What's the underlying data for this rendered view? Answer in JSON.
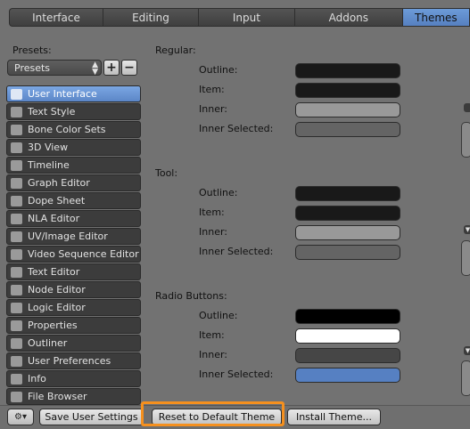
{
  "tabs": [
    {
      "label": "Interface",
      "active": false
    },
    {
      "label": "Editing",
      "active": false
    },
    {
      "label": "Input",
      "active": false
    },
    {
      "label": "Addons",
      "active": false
    },
    {
      "label": "Themes",
      "active": true
    }
  ],
  "presets": {
    "label": "Presets:",
    "selected": "Presets",
    "add": "+",
    "remove": "−"
  },
  "sidebar": {
    "items": [
      {
        "label": "User Interface",
        "icon": "user-interface-icon",
        "active": true
      },
      {
        "label": "Text Style",
        "icon": "text-style-icon"
      },
      {
        "label": "Bone Color Sets",
        "icon": "bone-color-sets-icon"
      },
      {
        "label": "3D View",
        "icon": "3d-view-icon"
      },
      {
        "label": "Timeline",
        "icon": "timeline-icon"
      },
      {
        "label": "Graph Editor",
        "icon": "graph-editor-icon"
      },
      {
        "label": "Dope Sheet",
        "icon": "dope-sheet-icon"
      },
      {
        "label": "NLA Editor",
        "icon": "nla-editor-icon"
      },
      {
        "label": "UV/Image Editor",
        "icon": "uv-image-editor-icon"
      },
      {
        "label": "Video Sequence Editor",
        "icon": "video-sequence-editor-icon"
      },
      {
        "label": "Text Editor",
        "icon": "text-editor-icon"
      },
      {
        "label": "Node Editor",
        "icon": "node-editor-icon"
      },
      {
        "label": "Logic Editor",
        "icon": "logic-editor-icon"
      },
      {
        "label": "Properties",
        "icon": "properties-icon"
      },
      {
        "label": "Outliner",
        "icon": "outliner-icon"
      },
      {
        "label": "User Preferences",
        "icon": "user-preferences-icon"
      },
      {
        "label": "Info",
        "icon": "info-icon"
      },
      {
        "label": "File Browser",
        "icon": "file-browser-icon"
      }
    ]
  },
  "sections": [
    {
      "title": "Regular:",
      "props": [
        {
          "label": "Outline:",
          "color": "#191919"
        },
        {
          "label": "Item:",
          "color": "#191919"
        },
        {
          "label": "Inner:",
          "color": "#999999"
        },
        {
          "label": "Inner Selected:",
          "color": "#646464"
        }
      ]
    },
    {
      "title": "Tool:",
      "props": [
        {
          "label": "Outline:",
          "color": "#191919"
        },
        {
          "label": "Item:",
          "color": "#191919"
        },
        {
          "label": "Inner:",
          "color": "#999999"
        },
        {
          "label": "Inner Selected:",
          "color": "#646464"
        }
      ]
    },
    {
      "title": "Radio Buttons:",
      "props": [
        {
          "label": "Outline:",
          "color": "#000000"
        },
        {
          "label": "Item:",
          "color": "#ffffff"
        },
        {
          "label": "Inner:",
          "color": "#464646"
        },
        {
          "label": "Inner Selected:",
          "color": "#5680c2"
        }
      ]
    }
  ],
  "bottom": {
    "editor_type_icon": "preferences-editor-icon",
    "save": "Save User Settings",
    "reset": "Reset to Default Theme",
    "install": "Install Theme..."
  },
  "colors": {
    "accent": "#5680c2",
    "highlight": "#f5901e"
  }
}
